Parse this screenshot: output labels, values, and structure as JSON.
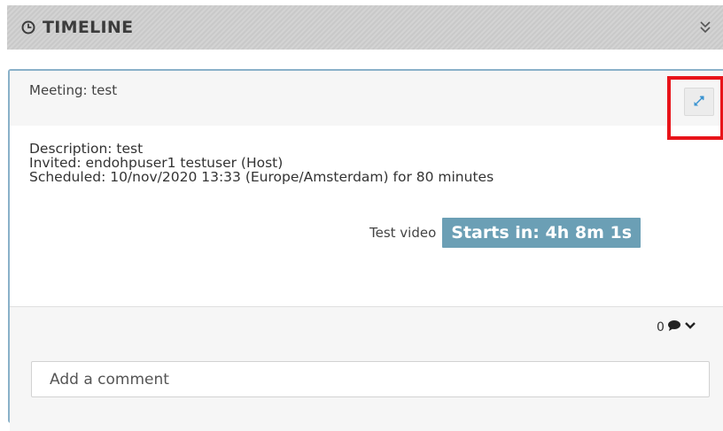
{
  "header": {
    "title": "TIMELINE"
  },
  "card": {
    "meeting_title": "Meeting: test",
    "description": "Description: test",
    "invited": "Invited: endohpuser1 testuser (Host)",
    "scheduled": "Scheduled: 10/nov/2020 13:33 (Europe/Amsterdam) for 80 minutes",
    "video_label": "Test video",
    "starts_in": "Starts in: 4h 8m 1s"
  },
  "comments": {
    "count": "0",
    "placeholder": "Add a comment"
  },
  "icons": {
    "header": "clock-icon",
    "collapse": "double-chevron-down-icon",
    "expand": "expand-arrows-icon",
    "comments": "comment-bubble-icon",
    "toggle": "chevron-down-icon"
  },
  "colors": {
    "header_bg": "#cfcfcf",
    "card_border": "#8ab1c9",
    "badge_bg": "#6b9fb5",
    "highlight": "#e8141a",
    "expand_arrow": "#3a93d1"
  }
}
